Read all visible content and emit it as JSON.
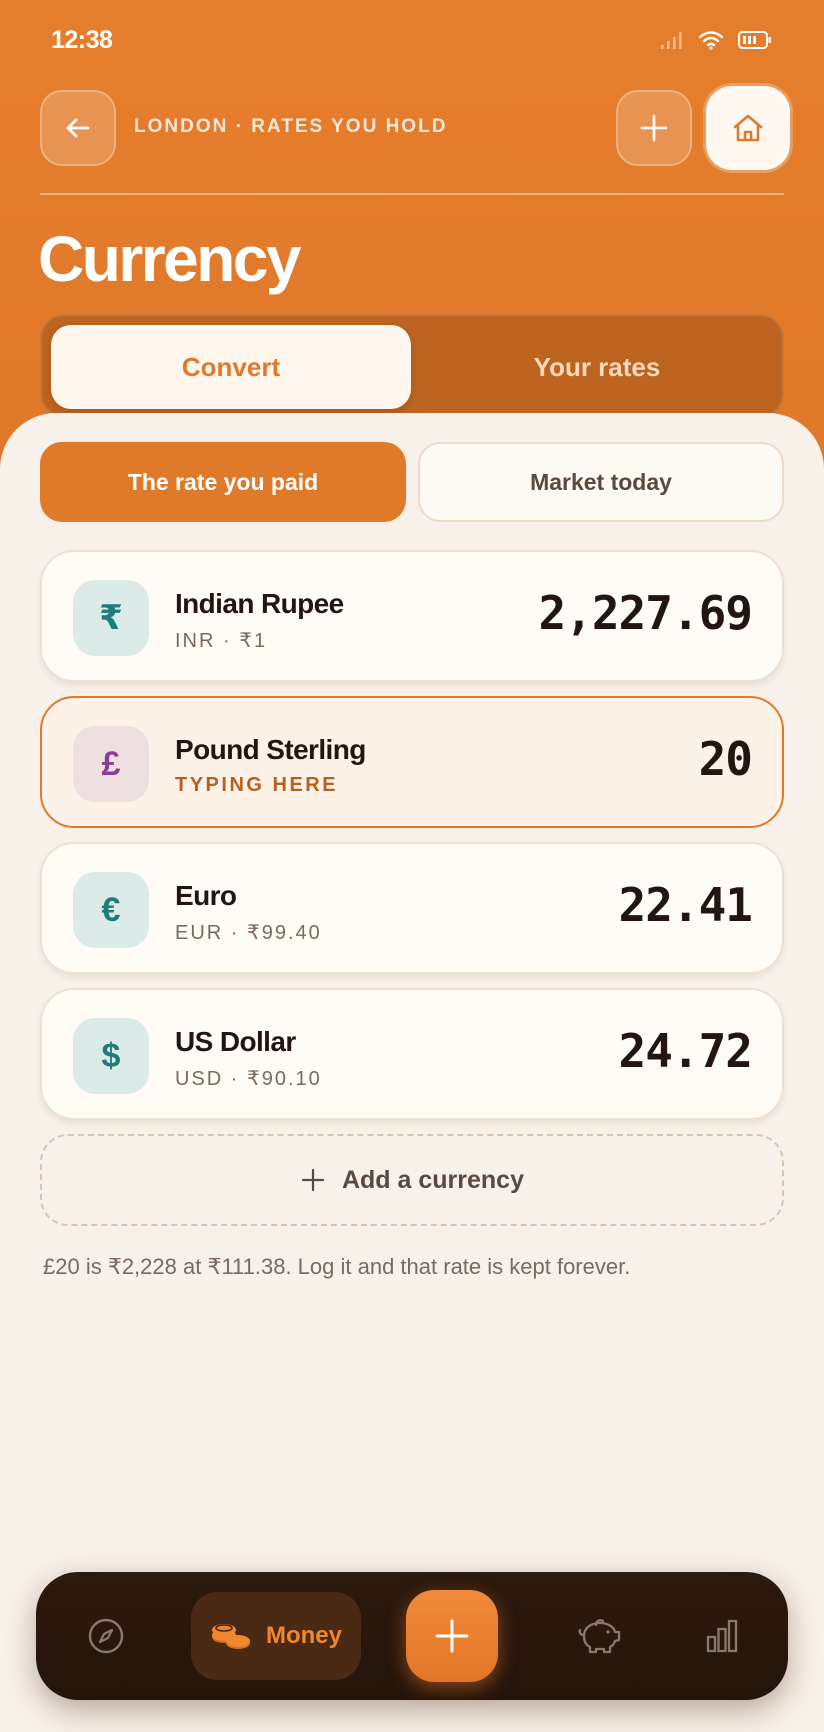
{
  "status": {
    "time": "12:38"
  },
  "header": {
    "caption": "LONDON · RATES YOU HOLD",
    "title": "Currency"
  },
  "tabs": {
    "convert": "Convert",
    "your_rates": "Your rates"
  },
  "modes": {
    "paid": "The rate you paid",
    "market": "Market today"
  },
  "currencies": [
    {
      "symbol": "₹",
      "name": "Indian Rupee",
      "sub": "INR · ₹1",
      "amount": "2,227.69"
    },
    {
      "symbol": "£",
      "name": "Pound Sterling",
      "sub": "TYPING HERE",
      "amount": "20"
    },
    {
      "symbol": "€",
      "name": "Euro",
      "sub": "EUR · ₹99.40",
      "amount": "22.41"
    },
    {
      "symbol": "$",
      "name": "US Dollar",
      "sub": "USD · ₹90.10",
      "amount": "24.72"
    }
  ],
  "add_currency": "Add a currency",
  "note": "£20 is ₹2,228 at ₹111.38. Log it and that rate is kept forever.",
  "nav": {
    "items": [
      "compass-icon",
      "coins-icon",
      "plus-icon",
      "piggy-bank-icon",
      "bar-chart-icon"
    ],
    "money_label": "Money"
  },
  "colors": {
    "accent": "#e07a2b",
    "nav_bg": "#2d1a0e",
    "sheet_bg": "#f8f1e9"
  }
}
